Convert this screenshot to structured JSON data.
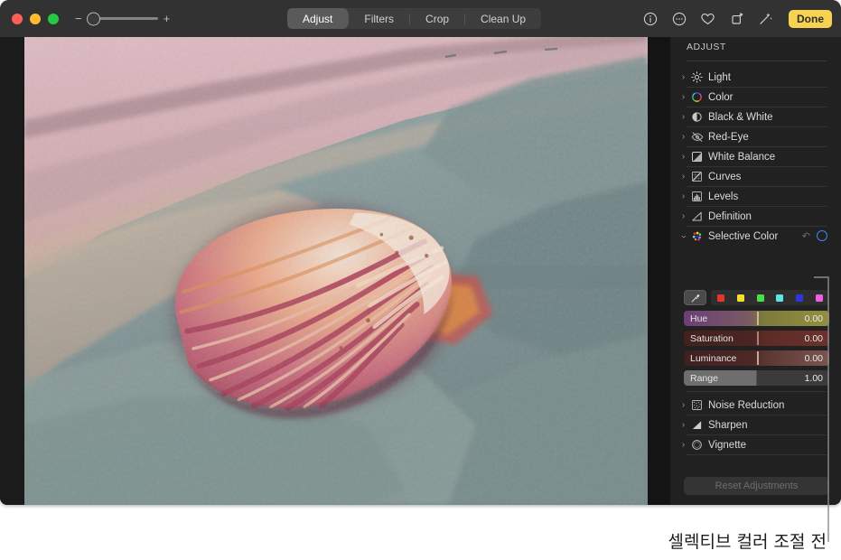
{
  "window": {
    "traffic_lights": [
      "close",
      "minimize",
      "zoom"
    ],
    "zoom_control": {
      "minus": "−",
      "plus": "+",
      "value_pct": 6
    }
  },
  "toolbar": {
    "segments": [
      {
        "label": "Adjust",
        "active": true
      },
      {
        "label": "Filters",
        "active": false
      },
      {
        "label": "Crop",
        "active": false
      },
      {
        "label": "Clean Up",
        "active": false
      }
    ],
    "icons": [
      {
        "name": "info-icon"
      },
      {
        "name": "more-options-icon"
      },
      {
        "name": "favorite-heart-icon"
      },
      {
        "name": "rotate-icon"
      },
      {
        "name": "auto-enhance-wand-icon"
      }
    ],
    "done_label": "Done",
    "done_color": "#f7d34f"
  },
  "sidebar": {
    "title": "ADJUST",
    "items": [
      {
        "label": "Light",
        "icon": "sun-icon",
        "expanded": false
      },
      {
        "label": "Color",
        "icon": "color-wheel-icon",
        "expanded": false
      },
      {
        "label": "Black & White",
        "icon": "half-circle-icon",
        "expanded": false
      },
      {
        "label": "Red-Eye",
        "icon": "eye-slash-icon",
        "expanded": false
      },
      {
        "label": "White Balance",
        "icon": "white-balance-icon",
        "expanded": false
      },
      {
        "label": "Curves",
        "icon": "curves-icon",
        "expanded": false
      },
      {
        "label": "Levels",
        "icon": "levels-histogram-icon",
        "expanded": false
      },
      {
        "label": "Definition",
        "icon": "definition-triangle-icon",
        "expanded": false
      }
    ],
    "selective_color": {
      "label": "Selective Color",
      "icon": "selective-color-dots-icon",
      "expanded": true,
      "reset_icon": "revert-arrow-icon",
      "toggle_icon": "enabled-circle-icon",
      "toggle_color": "#3f86f5",
      "eyedropper_icon": "eyedropper-icon",
      "swatches": [
        {
          "name": "red",
          "color": "#e2372c"
        },
        {
          "name": "yellow",
          "color": "#f4e12b"
        },
        {
          "name": "green",
          "color": "#4cdf4c"
        },
        {
          "name": "cyan",
          "color": "#58e6e6"
        },
        {
          "name": "blue",
          "color": "#2f33e0"
        },
        {
          "name": "magenta",
          "color": "#ee5fe2"
        }
      ],
      "sliders": [
        {
          "label": "Hue",
          "value": "0.00",
          "fill": 0.5,
          "from": "#6b3f78",
          "to": "#8e8a3a"
        },
        {
          "label": "Saturation",
          "value": "0.00",
          "fill": 0.5,
          "from": "#4a2a27",
          "to": "#5e2f29"
        },
        {
          "label": "Luminance",
          "value": "0.00",
          "fill": 0.5,
          "from": "#4b2523",
          "to": "#6d4a46"
        },
        {
          "label": "Range",
          "value": "1.00",
          "fill": 0.5,
          "from": "#6d6d6d",
          "to": "#3a3a3a"
        }
      ]
    },
    "items_bottom": [
      {
        "label": "Noise Reduction",
        "icon": "noise-reduction-icon",
        "expanded": false
      },
      {
        "label": "Sharpen",
        "icon": "sharpen-icon",
        "expanded": false
      },
      {
        "label": "Vignette",
        "icon": "vignette-circle-icon",
        "expanded": false
      }
    ],
    "reset_button": {
      "label": "Reset Adjustments",
      "disabled": true
    }
  },
  "photo": {
    "description": "scallop-shell-on-teal-towel"
  },
  "callout": {
    "caption": "셀렉티브 컬러 조절 전",
    "line_color": "#8c8c8c"
  }
}
